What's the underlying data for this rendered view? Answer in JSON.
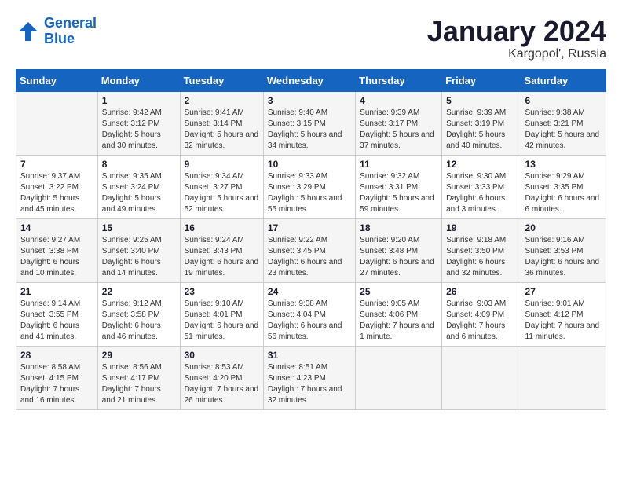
{
  "header": {
    "logo_line1": "General",
    "logo_line2": "Blue",
    "month": "January 2024",
    "location": "Kargopol', Russia"
  },
  "days_of_week": [
    "Sunday",
    "Monday",
    "Tuesday",
    "Wednesday",
    "Thursday",
    "Friday",
    "Saturday"
  ],
  "weeks": [
    [
      {
        "day": "",
        "sunrise": "",
        "sunset": "",
        "daylight": ""
      },
      {
        "day": "1",
        "sunrise": "Sunrise: 9:42 AM",
        "sunset": "Sunset: 3:12 PM",
        "daylight": "Daylight: 5 hours and 30 minutes."
      },
      {
        "day": "2",
        "sunrise": "Sunrise: 9:41 AM",
        "sunset": "Sunset: 3:14 PM",
        "daylight": "Daylight: 5 hours and 32 minutes."
      },
      {
        "day": "3",
        "sunrise": "Sunrise: 9:40 AM",
        "sunset": "Sunset: 3:15 PM",
        "daylight": "Daylight: 5 hours and 34 minutes."
      },
      {
        "day": "4",
        "sunrise": "Sunrise: 9:39 AM",
        "sunset": "Sunset: 3:17 PM",
        "daylight": "Daylight: 5 hours and 37 minutes."
      },
      {
        "day": "5",
        "sunrise": "Sunrise: 9:39 AM",
        "sunset": "Sunset: 3:19 PM",
        "daylight": "Daylight: 5 hours and 40 minutes."
      },
      {
        "day": "6",
        "sunrise": "Sunrise: 9:38 AM",
        "sunset": "Sunset: 3:21 PM",
        "daylight": "Daylight: 5 hours and 42 minutes."
      }
    ],
    [
      {
        "day": "7",
        "sunrise": "Sunrise: 9:37 AM",
        "sunset": "Sunset: 3:22 PM",
        "daylight": "Daylight: 5 hours and 45 minutes."
      },
      {
        "day": "8",
        "sunrise": "Sunrise: 9:35 AM",
        "sunset": "Sunset: 3:24 PM",
        "daylight": "Daylight: 5 hours and 49 minutes."
      },
      {
        "day": "9",
        "sunrise": "Sunrise: 9:34 AM",
        "sunset": "Sunset: 3:27 PM",
        "daylight": "Daylight: 5 hours and 52 minutes."
      },
      {
        "day": "10",
        "sunrise": "Sunrise: 9:33 AM",
        "sunset": "Sunset: 3:29 PM",
        "daylight": "Daylight: 5 hours and 55 minutes."
      },
      {
        "day": "11",
        "sunrise": "Sunrise: 9:32 AM",
        "sunset": "Sunset: 3:31 PM",
        "daylight": "Daylight: 5 hours and 59 minutes."
      },
      {
        "day": "12",
        "sunrise": "Sunrise: 9:30 AM",
        "sunset": "Sunset: 3:33 PM",
        "daylight": "Daylight: 6 hours and 3 minutes."
      },
      {
        "day": "13",
        "sunrise": "Sunrise: 9:29 AM",
        "sunset": "Sunset: 3:35 PM",
        "daylight": "Daylight: 6 hours and 6 minutes."
      }
    ],
    [
      {
        "day": "14",
        "sunrise": "Sunrise: 9:27 AM",
        "sunset": "Sunset: 3:38 PM",
        "daylight": "Daylight: 6 hours and 10 minutes."
      },
      {
        "day": "15",
        "sunrise": "Sunrise: 9:25 AM",
        "sunset": "Sunset: 3:40 PM",
        "daylight": "Daylight: 6 hours and 14 minutes."
      },
      {
        "day": "16",
        "sunrise": "Sunrise: 9:24 AM",
        "sunset": "Sunset: 3:43 PM",
        "daylight": "Daylight: 6 hours and 19 minutes."
      },
      {
        "day": "17",
        "sunrise": "Sunrise: 9:22 AM",
        "sunset": "Sunset: 3:45 PM",
        "daylight": "Daylight: 6 hours and 23 minutes."
      },
      {
        "day": "18",
        "sunrise": "Sunrise: 9:20 AM",
        "sunset": "Sunset: 3:48 PM",
        "daylight": "Daylight: 6 hours and 27 minutes."
      },
      {
        "day": "19",
        "sunrise": "Sunrise: 9:18 AM",
        "sunset": "Sunset: 3:50 PM",
        "daylight": "Daylight: 6 hours and 32 minutes."
      },
      {
        "day": "20",
        "sunrise": "Sunrise: 9:16 AM",
        "sunset": "Sunset: 3:53 PM",
        "daylight": "Daylight: 6 hours and 36 minutes."
      }
    ],
    [
      {
        "day": "21",
        "sunrise": "Sunrise: 9:14 AM",
        "sunset": "Sunset: 3:55 PM",
        "daylight": "Daylight: 6 hours and 41 minutes."
      },
      {
        "day": "22",
        "sunrise": "Sunrise: 9:12 AM",
        "sunset": "Sunset: 3:58 PM",
        "daylight": "Daylight: 6 hours and 46 minutes."
      },
      {
        "day": "23",
        "sunrise": "Sunrise: 9:10 AM",
        "sunset": "Sunset: 4:01 PM",
        "daylight": "Daylight: 6 hours and 51 minutes."
      },
      {
        "day": "24",
        "sunrise": "Sunrise: 9:08 AM",
        "sunset": "Sunset: 4:04 PM",
        "daylight": "Daylight: 6 hours and 56 minutes."
      },
      {
        "day": "25",
        "sunrise": "Sunrise: 9:05 AM",
        "sunset": "Sunset: 4:06 PM",
        "daylight": "Daylight: 7 hours and 1 minute."
      },
      {
        "day": "26",
        "sunrise": "Sunrise: 9:03 AM",
        "sunset": "Sunset: 4:09 PM",
        "daylight": "Daylight: 7 hours and 6 minutes."
      },
      {
        "day": "27",
        "sunrise": "Sunrise: 9:01 AM",
        "sunset": "Sunset: 4:12 PM",
        "daylight": "Daylight: 7 hours and 11 minutes."
      }
    ],
    [
      {
        "day": "28",
        "sunrise": "Sunrise: 8:58 AM",
        "sunset": "Sunset: 4:15 PM",
        "daylight": "Daylight: 7 hours and 16 minutes."
      },
      {
        "day": "29",
        "sunrise": "Sunrise: 8:56 AM",
        "sunset": "Sunset: 4:17 PM",
        "daylight": "Daylight: 7 hours and 21 minutes."
      },
      {
        "day": "30",
        "sunrise": "Sunrise: 8:53 AM",
        "sunset": "Sunset: 4:20 PM",
        "daylight": "Daylight: 7 hours and 26 minutes."
      },
      {
        "day": "31",
        "sunrise": "Sunrise: 8:51 AM",
        "sunset": "Sunset: 4:23 PM",
        "daylight": "Daylight: 7 hours and 32 minutes."
      },
      {
        "day": "",
        "sunrise": "",
        "sunset": "",
        "daylight": ""
      },
      {
        "day": "",
        "sunrise": "",
        "sunset": "",
        "daylight": ""
      },
      {
        "day": "",
        "sunrise": "",
        "sunset": "",
        "daylight": ""
      }
    ]
  ]
}
